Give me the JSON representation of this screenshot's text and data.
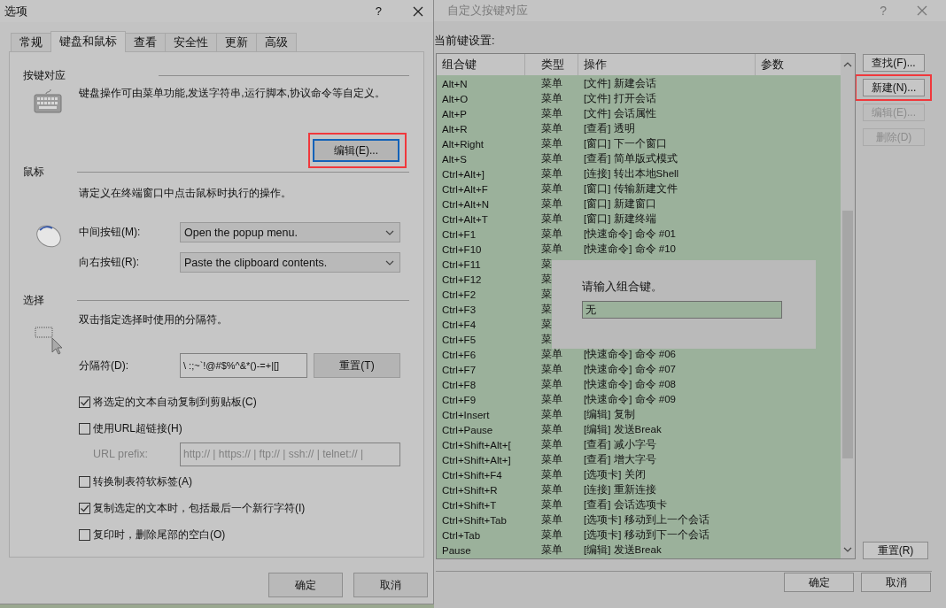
{
  "options_dialog": {
    "title": "选项",
    "help": "?",
    "tabs": [
      {
        "label": "常规",
        "selected": false
      },
      {
        "label": "键盘和鼠标",
        "selected": true
      },
      {
        "label": "查看",
        "selected": false
      },
      {
        "label": "安全性",
        "selected": false
      },
      {
        "label": "更新",
        "selected": false
      },
      {
        "label": "高级",
        "selected": false
      }
    ],
    "keyboard": {
      "heading": "按键对应",
      "description": "键盘操作可由菜单功能,发送字符串,运行脚本,协议命令等自定义。",
      "edit_button": {
        "label": "编辑(E)...",
        "focused": true,
        "highlighted": true
      }
    },
    "mouse": {
      "heading": "鼠标",
      "description": "请定义在终端窗口中点击鼠标时执行的操作。",
      "dropdowns": [
        {
          "label": "中间按钮(M):",
          "value": "Open the popup menu."
        },
        {
          "label": "向右按钮(R):",
          "value": "Paste the clipboard contents."
        }
      ]
    },
    "selection": {
      "heading": "选择",
      "description": "双击指定选择时使用的分隔符。",
      "separator": {
        "label": "分隔符(D):",
        "value": "\\ :;~`!@#$%^&*()-=+|[]"
      },
      "reset_button": "重置(T)"
    },
    "options": [
      {
        "kind": "checkbox",
        "label": "将选定的文本自动复制到剪贴板(C)",
        "checked": true
      },
      {
        "kind": "checkbox",
        "label": "使用URL超链接(H)",
        "checked": false
      },
      {
        "kind": "field",
        "label": "URL prefix:",
        "value": "http:// | https:// | ftp:// | ssh:// | telnet:// |",
        "disabled": true
      },
      {
        "kind": "checkbox",
        "label": "转换制表符软标签(A)",
        "checked": false
      },
      {
        "kind": "checkbox",
        "label": "复制选定的文本时，包括最后一个新行字符(I)",
        "checked": true
      },
      {
        "kind": "checkbox",
        "label": "复印时，删除尾部的空白(O)",
        "checked": false
      }
    ],
    "buttons": [
      "确定",
      "取消"
    ]
  },
  "keymap_dialog": {
    "title": "自定义按键对应",
    "help": "?",
    "list_label": "当前键设置:",
    "columns": [
      "组合键",
      "类型",
      "操作",
      "参数"
    ],
    "rows": [
      {
        "keys": "Alt+N",
        "type": "菜单",
        "action": "[文件] 新建会话"
      },
      {
        "keys": "Alt+O",
        "type": "菜单",
        "action": "[文件] 打开会话"
      },
      {
        "keys": "Alt+P",
        "type": "菜单",
        "action": "[文件] 会话属性"
      },
      {
        "keys": "Alt+R",
        "type": "菜单",
        "action": "[查看] 透明"
      },
      {
        "keys": "Alt+Right",
        "type": "菜单",
        "action": "[窗口] 下一个窗口"
      },
      {
        "keys": "Alt+S",
        "type": "菜单",
        "action": "[查看] 简单版式模式"
      },
      {
        "keys": "Ctrl+Alt+]",
        "type": "菜单",
        "action": "[连接] 转出本地Shell"
      },
      {
        "keys": "Ctrl+Alt+F",
        "type": "菜单",
        "action": "[窗口] 传输新建文件"
      },
      {
        "keys": "Ctrl+Alt+N",
        "type": "菜单",
        "action": "[窗口] 新建窗口"
      },
      {
        "keys": "Ctrl+Alt+T",
        "type": "菜单",
        "action": "[窗口] 新建终端"
      },
      {
        "keys": "Ctrl+F1",
        "type": "菜单",
        "action": "[快速命令] 命令 #01"
      },
      {
        "keys": "Ctrl+F10",
        "type": "菜单",
        "action": "[快速命令] 命令 #10"
      },
      {
        "keys": "Ctrl+F11",
        "type": "菜"
      },
      {
        "keys": "Ctrl+F12",
        "type": "菜"
      },
      {
        "keys": "Ctrl+F2",
        "type": "菜"
      },
      {
        "keys": "Ctrl+F3",
        "type": "菜"
      },
      {
        "keys": "Ctrl+F4",
        "type": "菜"
      },
      {
        "keys": "Ctrl+F5",
        "type": "菜"
      },
      {
        "keys": "Ctrl+F6",
        "type": "菜单",
        "action": "[快速命令] 命令 #06"
      },
      {
        "keys": "Ctrl+F7",
        "type": "菜单",
        "action": "[快速命令] 命令 #07"
      },
      {
        "keys": "Ctrl+F8",
        "type": "菜单",
        "action": "[快速命令] 命令 #08"
      },
      {
        "keys": "Ctrl+F9",
        "type": "菜单",
        "action": "[快速命令] 命令 #09"
      },
      {
        "keys": "Ctrl+Insert",
        "type": "菜单",
        "action": "[编辑] 复制"
      },
      {
        "keys": "Ctrl+Pause",
        "type": "菜单",
        "action": "[编辑] 发送Break"
      },
      {
        "keys": "Ctrl+Shift+Alt+[",
        "type": "菜单",
        "action": "[查看] 减小字号"
      },
      {
        "keys": "Ctrl+Shift+Alt+]",
        "type": "菜单",
        "action": "[查看] 增大字号"
      },
      {
        "keys": "Ctrl+Shift+F4",
        "type": "菜单",
        "action": "[选项卡] 关闭"
      },
      {
        "keys": "Ctrl+Shift+R",
        "type": "菜单",
        "action": "[连接] 重新连接"
      },
      {
        "keys": "Ctrl+Shift+T",
        "type": "菜单",
        "action": "[查看] 会话选项卡"
      },
      {
        "keys": "Ctrl+Shift+Tab",
        "type": "菜单",
        "action": "[选项卡] 移动到上一个会话"
      },
      {
        "keys": "Ctrl+Tab",
        "type": "菜单",
        "action": "[选项卡] 移动到下一个会话"
      },
      {
        "keys": "Pause",
        "type": "菜单",
        "action": "[编辑] 发送Break"
      }
    ],
    "side_buttons": [
      {
        "label": "查找(F)...",
        "disabled": false,
        "highlighted": false
      },
      {
        "label": "新建(N)...",
        "disabled": false,
        "highlighted": true
      },
      {
        "label": "编辑(E)...",
        "disabled": true,
        "highlighted": false
      },
      {
        "label": "删除(D)",
        "disabled": true,
        "highlighted": false
      }
    ],
    "reset_button": "重置(R)",
    "popup": {
      "prompt": "请输入组合键。",
      "value": "无"
    },
    "buttons": [
      "确定",
      "取消"
    ]
  }
}
